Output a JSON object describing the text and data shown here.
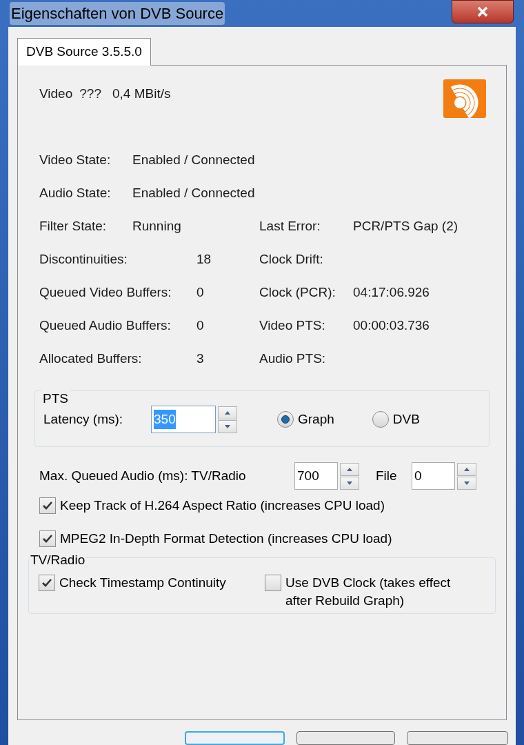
{
  "window": {
    "title": "Eigenschaften von DVB Source"
  },
  "tabs": [
    {
      "label": "DVB Source 3.5.5.0",
      "selected": true
    }
  ],
  "video_info": {
    "label": "Video",
    "codec": "???",
    "bitrate": "0,4 MBit/s"
  },
  "states": [
    {
      "label": "Video State:",
      "value": "Enabled / Connected"
    },
    {
      "label": "Audio State:",
      "value": "Enabled / Connected"
    }
  ],
  "stats": [
    {
      "kind": "state",
      "label": "Filter State:",
      "value": "Running",
      "right_label": "Last Error:",
      "right_value": "PCR/PTS Gap (2)"
    },
    {
      "kind": "count",
      "label": "Discontinuities:",
      "value": "18",
      "right_label": "Clock Drift:"
    },
    {
      "kind": "count",
      "label": "Queued Video Buffers:",
      "value": "0",
      "right_label": "Clock (PCR):",
      "right_value": "04:17:06.926"
    },
    {
      "kind": "count",
      "label": "Queued Audio Buffers:",
      "value": "0",
      "right_label": "Video PTS:",
      "right_value": "00:00:03.736"
    },
    {
      "kind": "count",
      "label": "Allocated Buffers:",
      "value": "3",
      "right_label": "Audio PTS:"
    }
  ],
  "pts_group": {
    "title": "PTS",
    "latency_label": "Latency (ms):",
    "latency_value": "350",
    "latency_value_selected": true,
    "radios": [
      {
        "label": "Graph",
        "selected": true
      },
      {
        "label": "DVB",
        "selected": false
      }
    ]
  },
  "max_queued": {
    "label": "Max. Queued Audio (ms): TV/Radio",
    "tv_radio_value": "700",
    "file_label": "File",
    "file_value": "0"
  },
  "checkboxes": [
    {
      "label": "Keep Track of H.264 Aspect Ratio (increases CPU load)",
      "checked": true
    },
    {
      "label": "MPEG2 In-Depth Format Detection (increases CPU load)",
      "checked": true
    }
  ],
  "tv_radio_group": {
    "title": "TV/Radio",
    "checkboxes": [
      {
        "label": "Check Timestamp Continuity",
        "checked": true
      },
      {
        "label": "Use DVB Clock (takes effect after Rebuild Graph)",
        "checked": false
      }
    ]
  }
}
